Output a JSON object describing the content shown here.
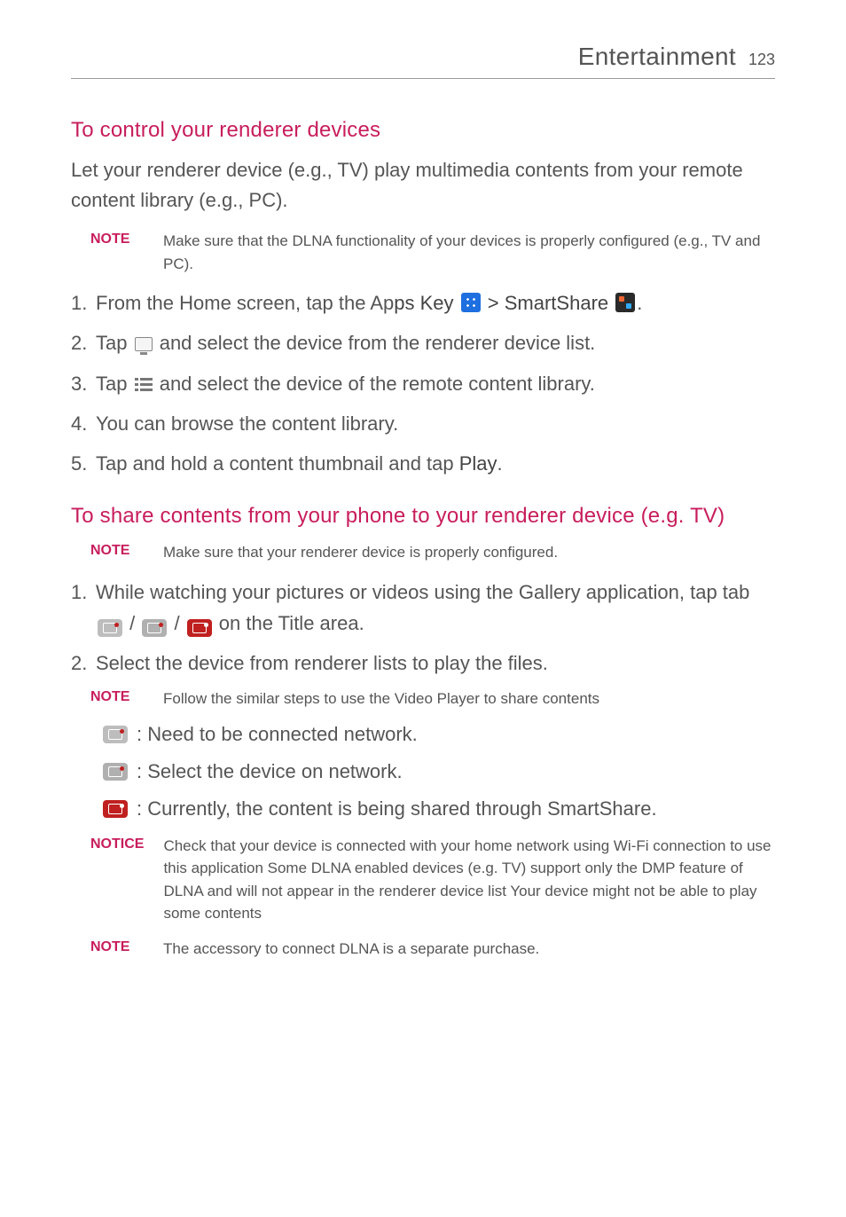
{
  "header": {
    "title": "Entertainment",
    "page_number": "123"
  },
  "section1": {
    "heading": "To control your renderer devices",
    "intro": "Let your renderer device (e.g., TV) play multimedia contents from your remote content library (e.g., PC).",
    "note1_label": "NOTE",
    "note1_text": "Make sure that the DLNA functionality of your devices is properly configured (e.g., TV and PC).",
    "step1_pre": "From the Home screen, tap the Ap",
    "step1_appskey": "ps Key",
    "step1_gt": " > ",
    "step1_smartshare": "SmartShare",
    "step1_post": ".",
    "step2_pre": "Tap ",
    "step2_post": " and select the device from the renderer device list.",
    "step3_pre": "Tap ",
    "step3_post": " and select the device of the remote content library.",
    "step4": "You can browse the content library.",
    "step5_pre": "Tap and hold a content thumbnail and tap ",
    "step5_play": "Play",
    "step5_post": "."
  },
  "section2": {
    "heading": "To share contents from your phone to your renderer device (e.g. TV)",
    "note1_label": "NOTE",
    "note1_text": "Make sure that your renderer device is properly configured.",
    "step1_pre": "While watching your pictures or videos using the Gallery application, tap tab ",
    "step1_sep": " / ",
    "step1_post": " on the Title area.",
    "step2": "Select the device from renderer lists to play the files.",
    "note2_label": "NOTE",
    "note2_text": "Follow the similar steps to use the Video Player to share contents",
    "legend_gray": ": Need to be connected network.",
    "legend_gray2": ": Select the device on network.",
    "legend_red": ": Currently, the content is being shared through SmartShare.",
    "notice_label": "NOTICE",
    "notice_text": "Check that your device is connected with your home network using Wi-Fi connection to use this application Some DLNA enabled devices (e.g. TV) support only the DMP feature of DLNA and will not appear in the renderer device list Your device might not be able to play some contents",
    "note3_label": "NOTE",
    "note3_text": "The accessory to connect DLNA is a separate purchase."
  }
}
